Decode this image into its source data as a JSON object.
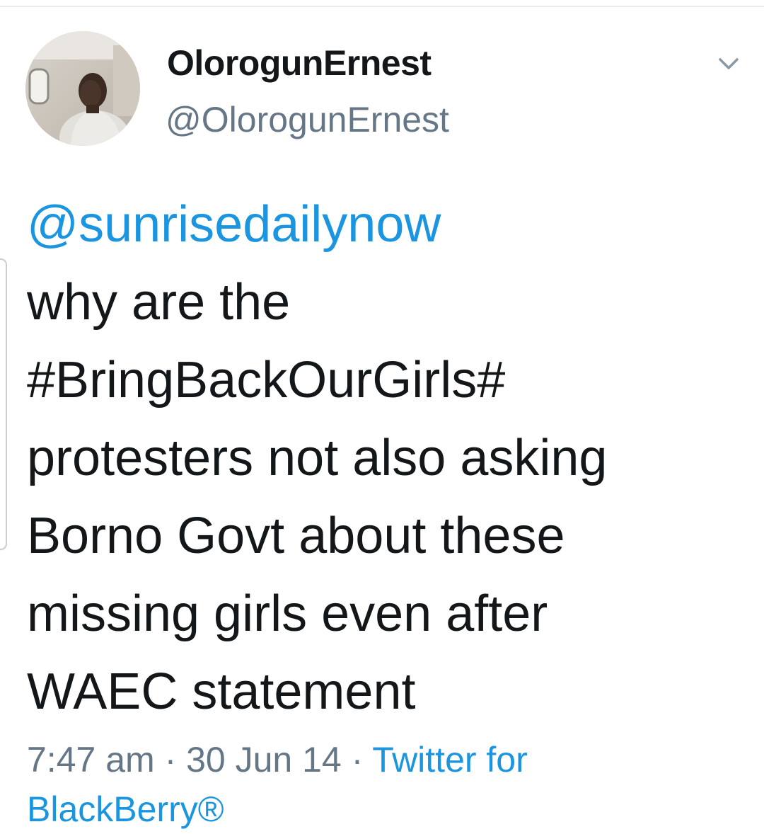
{
  "tweet": {
    "display_name": "OlorogunErnest",
    "screen_name": "@OlorogunErnest",
    "mention": "@sunrisedailynow",
    "text_lines": [
      "why are the",
      "#BringBackOurGirls#",
      "protesters not also asking",
      "Borno Govt about these",
      "missing girls even after",
      "WAEC statement"
    ],
    "time": "7:47 am",
    "separator": " · ",
    "date": "30 Jun 14",
    "source_line1": "Twitter for",
    "source_line2": "BlackBerry®"
  },
  "icons": {
    "caret": "chevron-down-icon",
    "avatar": "profile-photo"
  },
  "colors": {
    "link": "#1b95e0",
    "secondary_text": "#657786",
    "primary_text": "#14171a"
  }
}
